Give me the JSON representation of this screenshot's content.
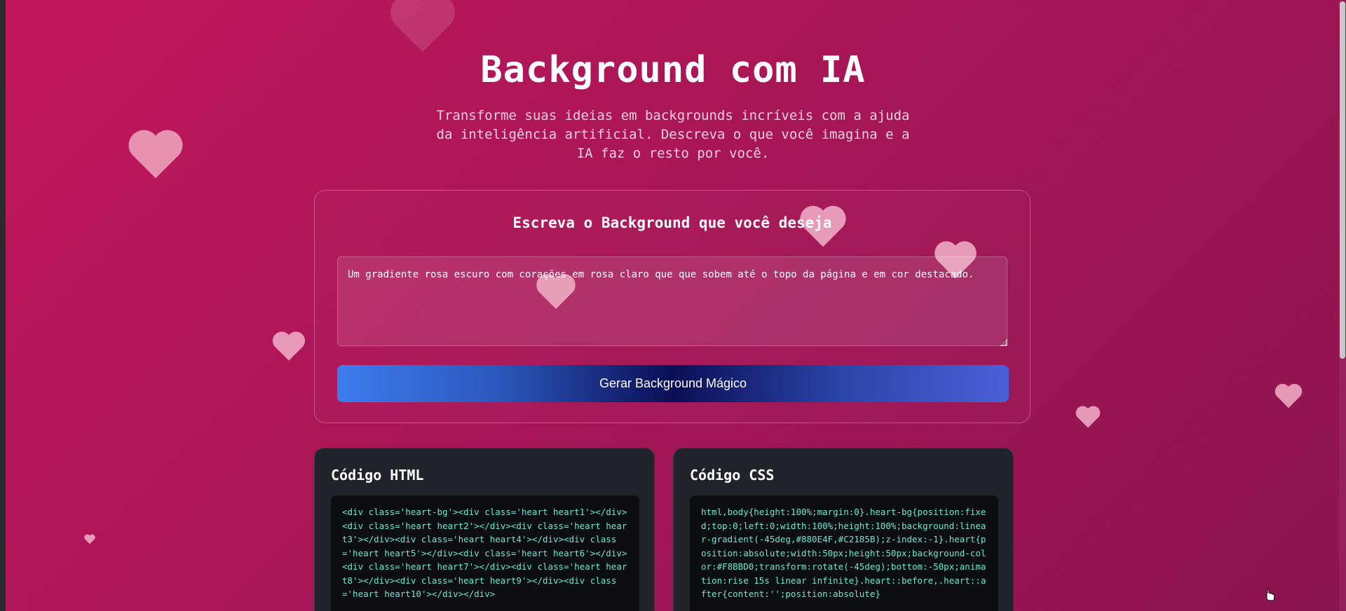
{
  "page": {
    "title": "Background com IA",
    "subtitle": "Transforme suas ideias em backgrounds incríveis com a ajuda da inteligência artificial. Descreva o que você imagina e a IA faz o resto por você."
  },
  "prompt_panel": {
    "heading": "Escreva o Background que você deseja",
    "textarea_value": "Um gradiente rosa escuro com corações em rosa claro que que sobem até o topo da página e em cor destacado.",
    "button_label": "Gerar Background Mágico"
  },
  "html_code": {
    "heading": "Código HTML",
    "code": "<div class='heart-bg'><div class='heart heart1'></div><div class='heart heart2'></div><div class='heart heart3'></div><div class='heart heart4'></div><div class='heart heart5'></div><div class='heart heart6'></div><div class='heart heart7'></div><div class='heart heart8'></div><div class='heart heart9'></div><div class='heart heart10'></div></div>"
  },
  "css_code": {
    "heading": "Código CSS",
    "code": "html,body{height:100%;margin:0}.heart-bg{position:fixed;top:0;left:0;width:100%;height:100%;background:linear-gradient(-45deg,#880E4F,#C2185B);z-index:-1}.heart{position:absolute;width:50px;height:50px;background-color:#F8BBD0;transform:rotate(-45deg);bottom:-50px;animation:rise 15s linear infinite}.heart::before,.heart::after{content:'';position:absolute}"
  },
  "colors": {
    "background_start": "#c2185b",
    "background_end": "#8b1450",
    "heart": "#f8bbd0",
    "code_text": "#6ee7d0",
    "button_gradient_start": "#3d7df0",
    "button_gradient_mid": "#0b0e55"
  },
  "icons": [
    "heart-icon",
    "resize-grip-icon",
    "cursor-icon"
  ]
}
